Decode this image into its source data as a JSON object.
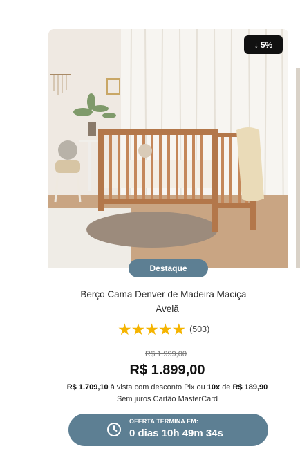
{
  "product": {
    "discount_badge": "5%",
    "discount_arrow": "↓",
    "highlight": "Destaque",
    "title": "Berço Cama Denver de Madeira Maciça – Avelã",
    "rating_stars": "★★★★★",
    "rating_count": "(503)",
    "old_price": "R$ 1.999,00",
    "price": "R$ 1.899,00",
    "pix_price": "R$ 1.709,10",
    "pix_text": "à vista com desconto Pix ou",
    "installments": "10x",
    "installments_connector": "de",
    "installment_value": "R$ 189,90",
    "installments_text": "Sem juros Cartão MasterCard"
  },
  "offer": {
    "label": "OFERTA TERMINA EM:",
    "countdown": "0 dias 10h 49m 34s"
  },
  "colors": {
    "accent": "#5d7f93",
    "badge_bg": "#111111",
    "star": "#f5b400"
  },
  "icons": {
    "discount": "arrow-down-icon",
    "timer": "clock-icon"
  }
}
